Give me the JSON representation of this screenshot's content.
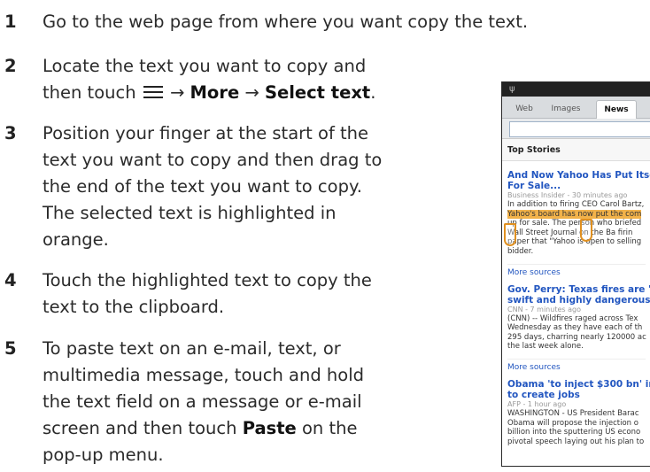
{
  "steps": [
    {
      "num": "1",
      "lines": [
        "Go to the web page from where you want copy the text."
      ]
    },
    {
      "num": "2",
      "line1": "Locate the text you want to copy and",
      "line2_pre": "then touch",
      "arrow1": "→",
      "more": "More",
      "arrow2": "→",
      "select": "Select text",
      "period": "."
    },
    {
      "num": "3",
      "lines": [
        "Position your finger at the start of the",
        "text you want to copy and then drag to",
        "the end of the text you want to copy.",
        "The selected text is highlighted in",
        "orange."
      ]
    },
    {
      "num": "4",
      "lines": [
        "Touch the highlighted text to copy the",
        "text to the clipboard."
      ]
    },
    {
      "num": "5",
      "line1": "To paste text on an e-mail, text, or",
      "line2": "multimedia message, touch and hold",
      "line3": "the text field on a message or e-mail",
      "line4_pre": "screen and then touch",
      "paste": "Paste",
      "line4_post": "on the",
      "line5": "pop-up menu."
    }
  ],
  "menu_icon": "hamburger-menu-icon",
  "phone": {
    "status_icon": "usb-icon",
    "status_glyph": "ψ",
    "tabs": [
      "Web",
      "Images",
      "News"
    ],
    "active_tab": "News",
    "section": "Top Stories",
    "stories": [
      {
        "title": [
          "And Now Yahoo Has Put Itse",
          "For Sale..."
        ],
        "meta": "Business Insider - 30 minutes ago",
        "body": [
          "In addition to firing CEO Carol Bartz,",
          "Yahoo's board has now put the com",
          "up for sale. The person who briefed",
          "Wall Street Journal on the Ba  firin",
          "paper that \"Yahoo is open to selling",
          "bidder."
        ],
        "more": "More sources"
      },
      {
        "title": [
          "Gov. Perry: Texas fires are 'r",
          "swift and highly dangerous'"
        ],
        "meta": "CNN - 7 minutes ago",
        "body": [
          "(CNN) -- Wildfires raged across Tex",
          "Wednesday as they have each of th",
          "295 days, charring nearly 120000 ac",
          "the last week alone."
        ],
        "more": "More sources"
      },
      {
        "title": [
          "Obama 'to inject $300 bn' in",
          "to create jobs"
        ],
        "meta": "AFP - 1 hour ago",
        "body": [
          "WASHINGTON - US President Barac",
          "Obama will propose the injection o",
          "billion into the sputtering US econo",
          "pivotal speech laying out his plan to"
        ],
        "more": ""
      }
    ]
  }
}
